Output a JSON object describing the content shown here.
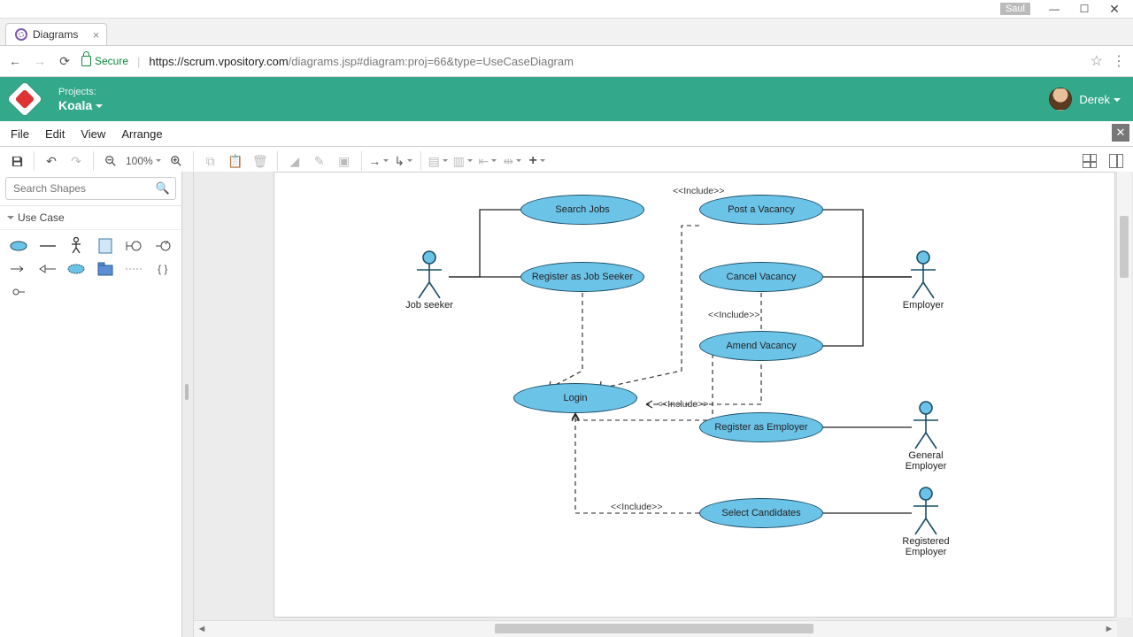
{
  "window": {
    "user_badge": "Saul"
  },
  "browser": {
    "tab_title": "Diagrams",
    "secure_label": "Secure",
    "url_host": "https://scrum.vpository.com",
    "url_path": "/diagrams.jsp#diagram:proj=66&type=UseCaseDiagram"
  },
  "header": {
    "projects_label": "Projects:",
    "project_name": "Koala",
    "user_name": "Derek"
  },
  "menubar": {
    "items": [
      "File",
      "Edit",
      "View",
      "Arrange"
    ]
  },
  "toolbar": {
    "zoom": "100%"
  },
  "sidepanel": {
    "search_placeholder": "Search Shapes",
    "palette_title": "Use Case"
  },
  "diagram": {
    "actors": {
      "job_seeker": "Job seeker",
      "employer": "Employer",
      "general_employer": "General Employer",
      "registered_employer": "Registered Employer"
    },
    "usecases": {
      "search_jobs": "Search Jobs",
      "register_seeker": "Register as Job Seeker",
      "login": "Login",
      "post_vacancy": "Post a Vacancy",
      "cancel_vacancy": "Cancel Vacancy",
      "amend_vacancy": "Amend Vacancy",
      "register_employer": "Register as Employer",
      "select_candidates": "Select Candidates"
    },
    "stereotypes": {
      "inc1": "<<Include>>",
      "inc2": "<<Include>>",
      "inc3": "<<Include>>",
      "inc4": "<<Include>>"
    }
  }
}
